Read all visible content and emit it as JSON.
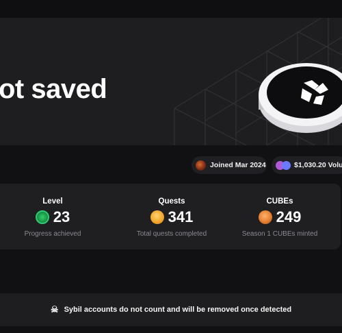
{
  "hero": {
    "title": "ot saved"
  },
  "profile": {
    "joined": "Joined Mar 2024",
    "volume": "$1,030.20 Volu"
  },
  "stats": [
    {
      "label": "Level",
      "value": "23",
      "sub": "Progress achieved",
      "icon": "level-badge-icon"
    },
    {
      "label": "Quests",
      "value": "341",
      "sub": "Total quests completed",
      "icon": "quest-coin-icon"
    },
    {
      "label": "CUBEs",
      "value": "249",
      "sub": "Season 1 CUBEs minted",
      "icon": "cube-coin-icon"
    }
  ],
  "notice": {
    "text": "Sybil accounts do not count and will be removed once detected",
    "icon": "skull-icon"
  },
  "colors": {
    "background": "#111114",
    "panel": "#1f1f22",
    "muted_text": "#8a8a92",
    "level_green": "#2ecc71",
    "quest_gold": "#f0a32a",
    "cube_bronze": "#e07a2c"
  }
}
